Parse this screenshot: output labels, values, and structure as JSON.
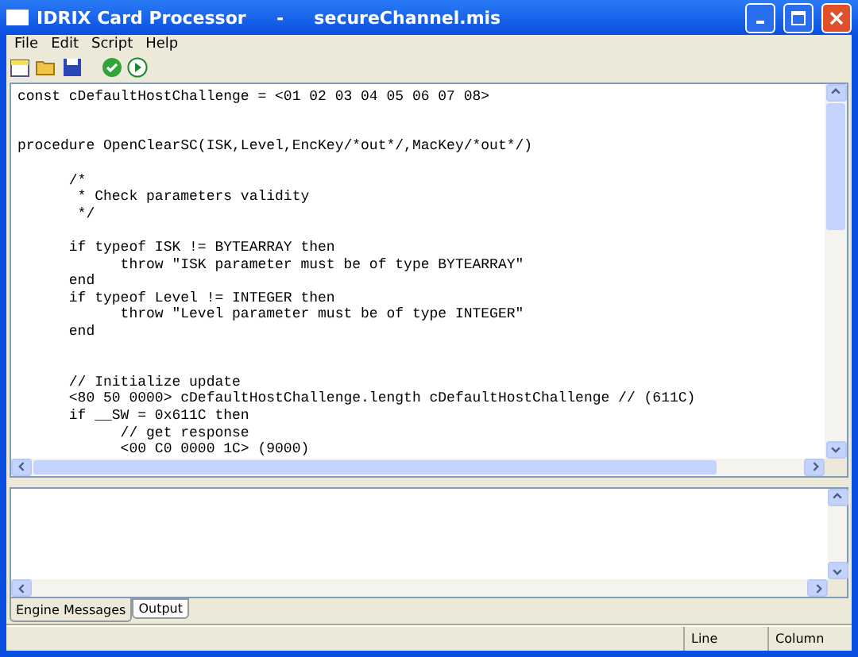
{
  "window": {
    "title": "IDRIX Card Processor     -     secureChannel.mis"
  },
  "menu": [
    "File",
    "Edit",
    "Script",
    "Help"
  ],
  "toolbar": [
    {
      "kind": "new"
    },
    {
      "kind": "open"
    },
    {
      "kind": "save"
    },
    {
      "kind": "gap"
    },
    {
      "kind": "check"
    },
    {
      "kind": "run"
    }
  ],
  "editor": {
    "lines": [
      {
        "kind": "code",
        "text": "const cDefaultHostChallenge = <01 02 03 04 05 06 07 08>"
      },
      {
        "kind": "blank"
      },
      {
        "kind": "blank"
      },
      {
        "kind": "code",
        "text": "procedure OpenClearSC(ISK,Level,EncKey/*out*/,MacKey/*out*/)"
      },
      {
        "kind": "blank"
      },
      {
        "kind": "code",
        "text": "      /*"
      },
      {
        "kind": "code",
        "text": "       * Check parameters validity"
      },
      {
        "kind": "code",
        "text": "       */"
      },
      {
        "kind": "blank"
      },
      {
        "kind": "code",
        "text": "      if typeof ISK != BYTEARRAY then"
      },
      {
        "kind": "code",
        "text": "            throw \"ISK parameter must be of type BYTEARRAY\""
      },
      {
        "kind": "code",
        "text": "      end"
      },
      {
        "kind": "code",
        "text": "      if typeof Level != INTEGER then"
      },
      {
        "kind": "code",
        "text": "            throw \"Level parameter must be of type INTEGER\""
      },
      {
        "kind": "code",
        "text": "      end"
      },
      {
        "kind": "blank"
      },
      {
        "kind": "blank"
      },
      {
        "kind": "code",
        "text": "      // Initialize update"
      },
      {
        "kind": "code",
        "text": "      <80 50 0000> cDefaultHostChallenge.length cDefaultHostChallenge // (611C)"
      },
      {
        "kind": "code",
        "text": "      if __SW = 0x611C then"
      },
      {
        "kind": "code",
        "text": "            // get response"
      },
      {
        "kind": "code",
        "text": "            <00 C0 0000 1C> (9000)"
      }
    ]
  },
  "tabs": [
    {
      "label": "Engine Messages",
      "selected": true
    },
    {
      "label": "Output",
      "selected": false
    }
  ],
  "status_bar": [
    "Line",
    "Column"
  ]
}
